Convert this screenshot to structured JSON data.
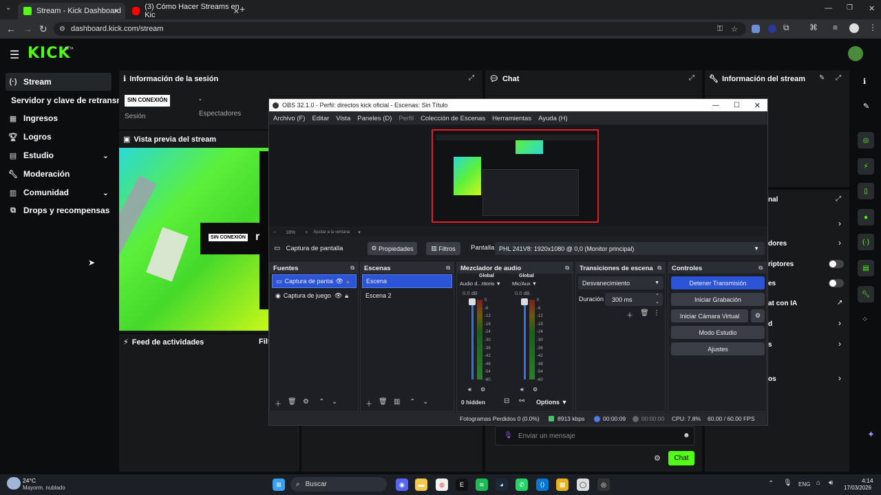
{
  "browser": {
    "tabs": [
      {
        "title": "Stream - Kick Dashboard",
        "favicon_color": "#53fc18"
      },
      {
        "title": "(3) Cómo Hacer Streams en Kic",
        "favicon_color": "#ff0000"
      }
    ],
    "url": "dashboard.kick.com/stream",
    "icons": [
      "dropdown-icon",
      "back-icon",
      "forward-icon",
      "reload-icon",
      "site-info-icon",
      "key-icon",
      "star-icon",
      "extensions-icon",
      "profile-icon",
      "menu-icon"
    ]
  },
  "kick": {
    "logo": "KICK",
    "logo_badge": "BETA",
    "accent": "#53fc18",
    "sidebar": [
      {
        "label": "Stream",
        "icon": "stream-icon",
        "active": true
      },
      {
        "label": "Servidor y clave de retransm",
        "icon": "",
        "active": false
      },
      {
        "label": "Ingresos",
        "icon": "revenue-icon",
        "active": false
      },
      {
        "label": "Logros",
        "icon": "trophy-icon",
        "active": false
      },
      {
        "label": "Estudio",
        "icon": "studio-icon",
        "active": false,
        "expand": true
      },
      {
        "label": "Moderación",
        "icon": "wrench-icon",
        "active": false
      },
      {
        "label": "Comunidad",
        "icon": "community-icon",
        "active": false,
        "expand": true
      },
      {
        "label": "Drops y recompensas",
        "icon": "drops-icon",
        "active": false
      }
    ],
    "session": {
      "title": "Información de la sesión",
      "status": "SIN CONEXIÓN",
      "session_label": "Sesión",
      "viewers_value": "-",
      "viewers_label": "Espectadores"
    },
    "preview": {
      "title": "Vista previa del stream",
      "badge": "SIN CONEXIÓN",
      "overlay_text": "rin"
    },
    "feed": {
      "title": "Feed de actividades",
      "filter": "Filt"
    },
    "chat": {
      "title": "Chat",
      "placeholder": "Enviar un mensaje",
      "send": "Chat"
    },
    "stream_info": {
      "title": "Información del stream",
      "partial": [
        "nal",
        "dores",
        "riptores",
        "es",
        "at con IA",
        "d",
        "s",
        "os"
      ]
    }
  },
  "obs": {
    "title": "OBS 32.1.0 - Perfil: directos kick oficial - Escenas: Sin Título",
    "menu": [
      "Archivo (F)",
      "Editar",
      "Vista",
      "Paneles (D)",
      "Perfil",
      "Colección de Escenas",
      "Herramientas",
      "Ayuda (H)"
    ],
    "zoom": "18%",
    "fit": "Ajustar a la ventana",
    "source_bar": {
      "source": "Captura de pantalla",
      "properties": "Propiedades",
      "filters": "Filtros",
      "display_label": "Pantalla",
      "display_value": "PHL 241V8: 1920x1080 @ 0,0 (Monitor principal)"
    },
    "sources": {
      "title": "Fuentes",
      "items": [
        "Captura de pantalla",
        "Captura de juego"
      ]
    },
    "scenes": {
      "title": "Escenas",
      "items": [
        "Escena",
        "Escena 2"
      ]
    },
    "mixer": {
      "title": "Mezclador de audio",
      "channels": [
        {
          "tag": "Global",
          "name": "Audio d...ritorio",
          "db": "0.0 dB"
        },
        {
          "tag": "Global",
          "name": "Mic/Aux",
          "db": "0.0 dB"
        }
      ],
      "scale": [
        "0",
        "-6",
        "-12",
        "-18",
        "-24",
        "-30",
        "-36",
        "-42",
        "-48",
        "-54",
        "-60"
      ],
      "hidden": "0 hidden",
      "options": "Options"
    },
    "transitions": {
      "title": "Transiciones de escena",
      "type": "Desvanecimiento",
      "duration_label": "Duración",
      "duration_value": "300 ms"
    },
    "controls": {
      "title": "Controles",
      "buttons": [
        "Detener Transmisión",
        "Iniciar Grabación",
        "Iniciar Cámara Virtual",
        "Modo Estudio",
        "Ajustes"
      ]
    },
    "status": {
      "dropped": "Fotogramas Perdidos 0 (0.0%)",
      "bitrate": "8913 kbps",
      "stream_time": "00:00:09",
      "rec_time": "00:00:00",
      "cpu": "CPU: 7.8%",
      "fps": "60.00 / 60.00 FPS"
    }
  },
  "taskbar": {
    "weather_temp": "24°C",
    "weather_desc": "Mayorm. nublado",
    "search": "Buscar",
    "lang": "ENG",
    "time": "4:14",
    "date": "17/03/2026"
  }
}
